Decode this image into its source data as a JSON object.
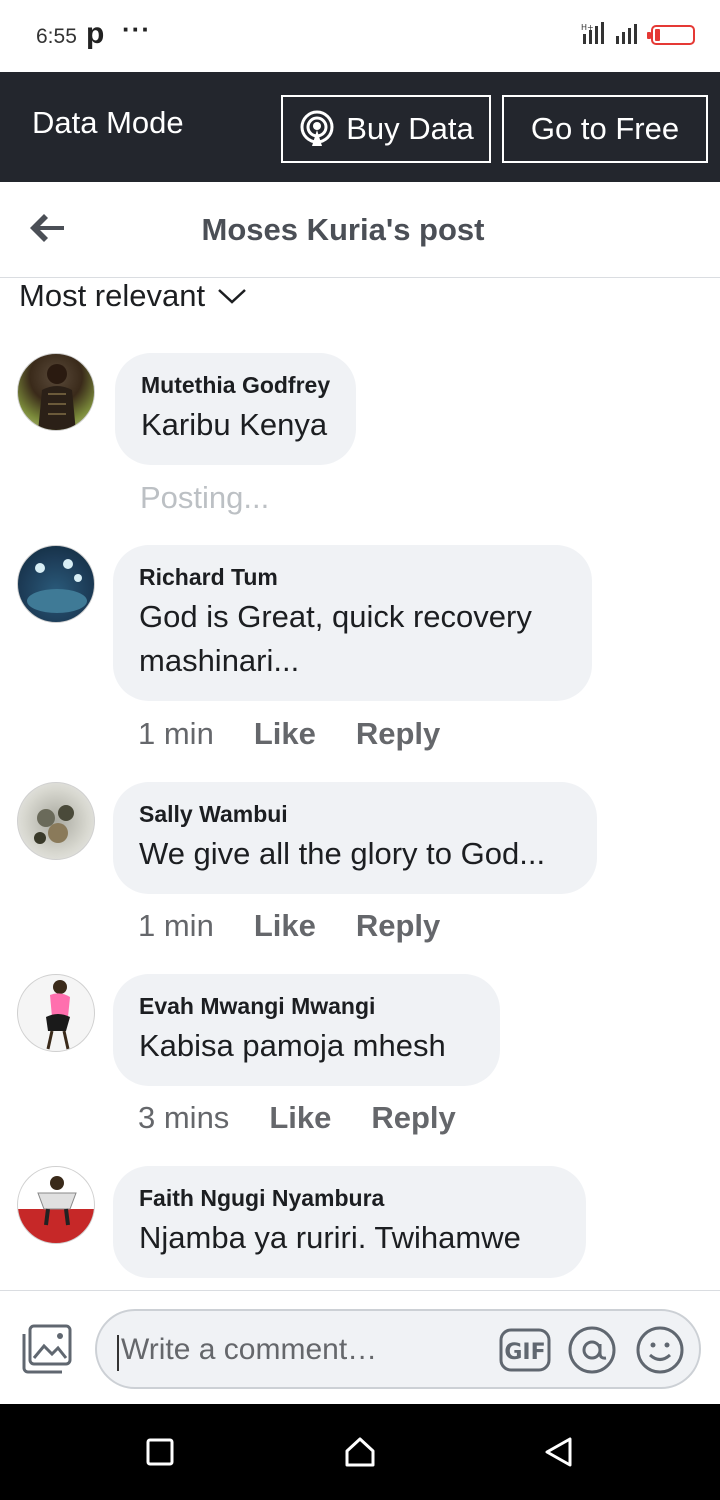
{
  "status_bar": {
    "time": "6:55",
    "app_letter": "p",
    "more": "···"
  },
  "data_bar": {
    "label": "Data Mode",
    "buy_data": "Buy Data",
    "go_free": "Go to Free"
  },
  "header": {
    "title": "Moses Kuria's post"
  },
  "sort": {
    "label": "Most relevant"
  },
  "comments": [
    {
      "author": "Mutethia Godfrey",
      "text": "Karibu Kenya",
      "status": "Posting..."
    },
    {
      "author": "Richard Tum",
      "text_line1": "God is Great, quick recovery",
      "text_line2": "mashinari...",
      "time": "1 min",
      "like": "Like",
      "reply": "Reply"
    },
    {
      "author": "Sally Wambui",
      "text": "We give all the glory to God...",
      "time": "1 min",
      "like": "Like",
      "reply": "Reply"
    },
    {
      "author": "Evah Mwangi Mwangi",
      "text": "Kabisa pamoja mhesh",
      "time": "3 mins",
      "like": "Like",
      "reply": "Reply"
    },
    {
      "author": "Faith Ngugi Nyambura",
      "text": "Njamba ya ruriri. Twihamwe"
    }
  ],
  "composer": {
    "placeholder": "Write a comment…",
    "gif": "GIF"
  },
  "colors": {
    "data_bar_bg": "#23262d",
    "bubble_bg": "#f0f2f5",
    "meta_text": "#65676b",
    "battery": "#e53935"
  }
}
